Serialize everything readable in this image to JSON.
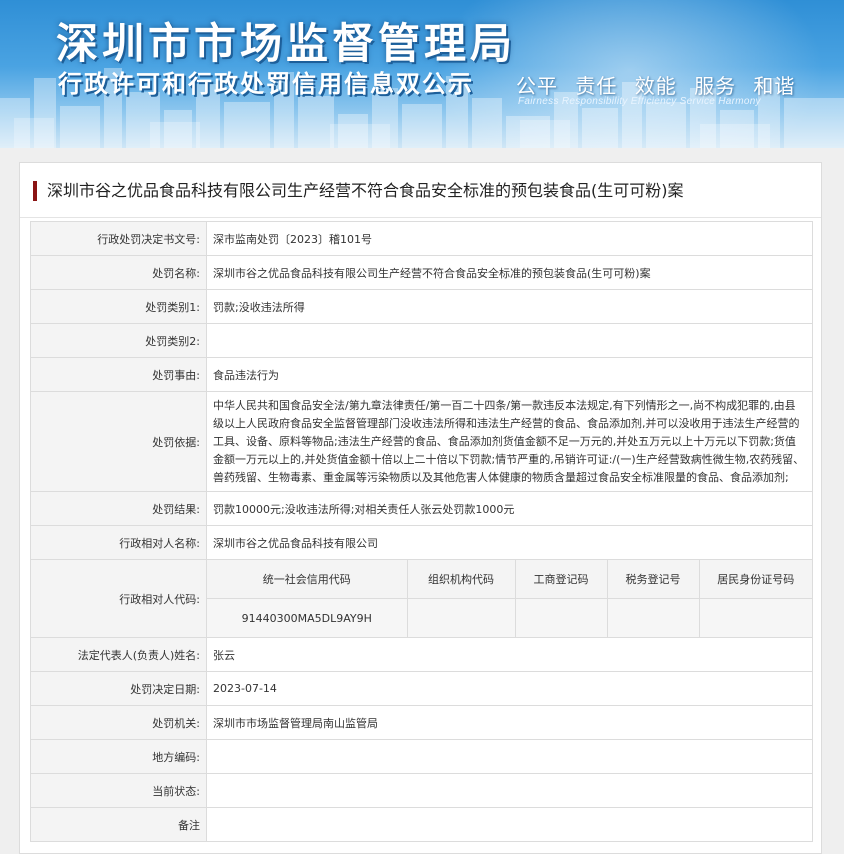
{
  "header": {
    "title": "深圳市市场监督管理局",
    "subtitle": "行政许可和行政处罚信用信息双公示",
    "slogan_cn": "公平 责任 效能 服务 和谐",
    "slogan_en": "Fairness Responsibility Efficiency Service Harmony"
  },
  "case_title": "深圳市谷之优品食品科技有限公司生产经营不符合食品安全标准的预包装食品(生可可粉)案",
  "fields": {
    "decision_no": {
      "label": "行政处罚决定书文号:",
      "value": "深市监南处罚〔2023〕稽101号"
    },
    "penalty_name": {
      "label": "处罚名称:",
      "value": "深圳市谷之优品食品科技有限公司生产经营不符合食品安全标准的预包装食品(生可可粉)案"
    },
    "category1": {
      "label": "处罚类别1:",
      "value": "罚款;没收违法所得"
    },
    "category2": {
      "label": "处罚类别2:",
      "value": ""
    },
    "reason": {
      "label": "处罚事由:",
      "value": "食品违法行为"
    },
    "basis": {
      "label": "处罚依据:",
      "value": "中华人民共和国食品安全法/第九章法律责任/第一百二十四条/第一款违反本法规定,有下列情形之一,尚不构成犯罪的,由县级以上人民政府食品安全监督管理部门没收违法所得和违法生产经营的食品、食品添加剂,并可以没收用于违法生产经营的工具、设备、原料等物品;违法生产经营的食品、食品添加剂货值金额不足一万元的,并处五万元以上十万元以下罚款;货值金额一万元以上的,并处货值金额十倍以上二十倍以下罚款;情节严重的,吊销许可证:/(一)生产经营致病性微生物,农药残留、兽药残留、生物毒素、重金属等污染物质以及其他危害人体健康的物质含量超过食品安全标准限量的食品、食品添加剂;"
    },
    "result": {
      "label": "处罚结果:",
      "value": "罚款10000元;没收违法所得;对相关责任人张云处罚款1000元"
    },
    "party_name": {
      "label": "行政相对人名称:",
      "value": "深圳市谷之优品食品科技有限公司"
    },
    "party_codes": {
      "label": "行政相对人代码:",
      "headers": [
        "统一社会信用代码",
        "组织机构代码",
        "工商登记码",
        "税务登记号",
        "居民身份证号码"
      ],
      "values": [
        "91440300MA5DL9AY9H",
        "",
        "",
        "",
        ""
      ]
    },
    "legal_rep": {
      "label": "法定代表人(负责人)姓名:",
      "value": "张云"
    },
    "decision_date": {
      "label": "处罚决定日期:",
      "value": "2023-07-14"
    },
    "authority": {
      "label": "处罚机关:",
      "value": "深圳市市场监督管理局南山监管局"
    },
    "region_code": {
      "label": "地方编码:",
      "value": ""
    },
    "status": {
      "label": "当前状态:",
      "value": ""
    },
    "remark": {
      "label": "备注",
      "value": ""
    }
  }
}
